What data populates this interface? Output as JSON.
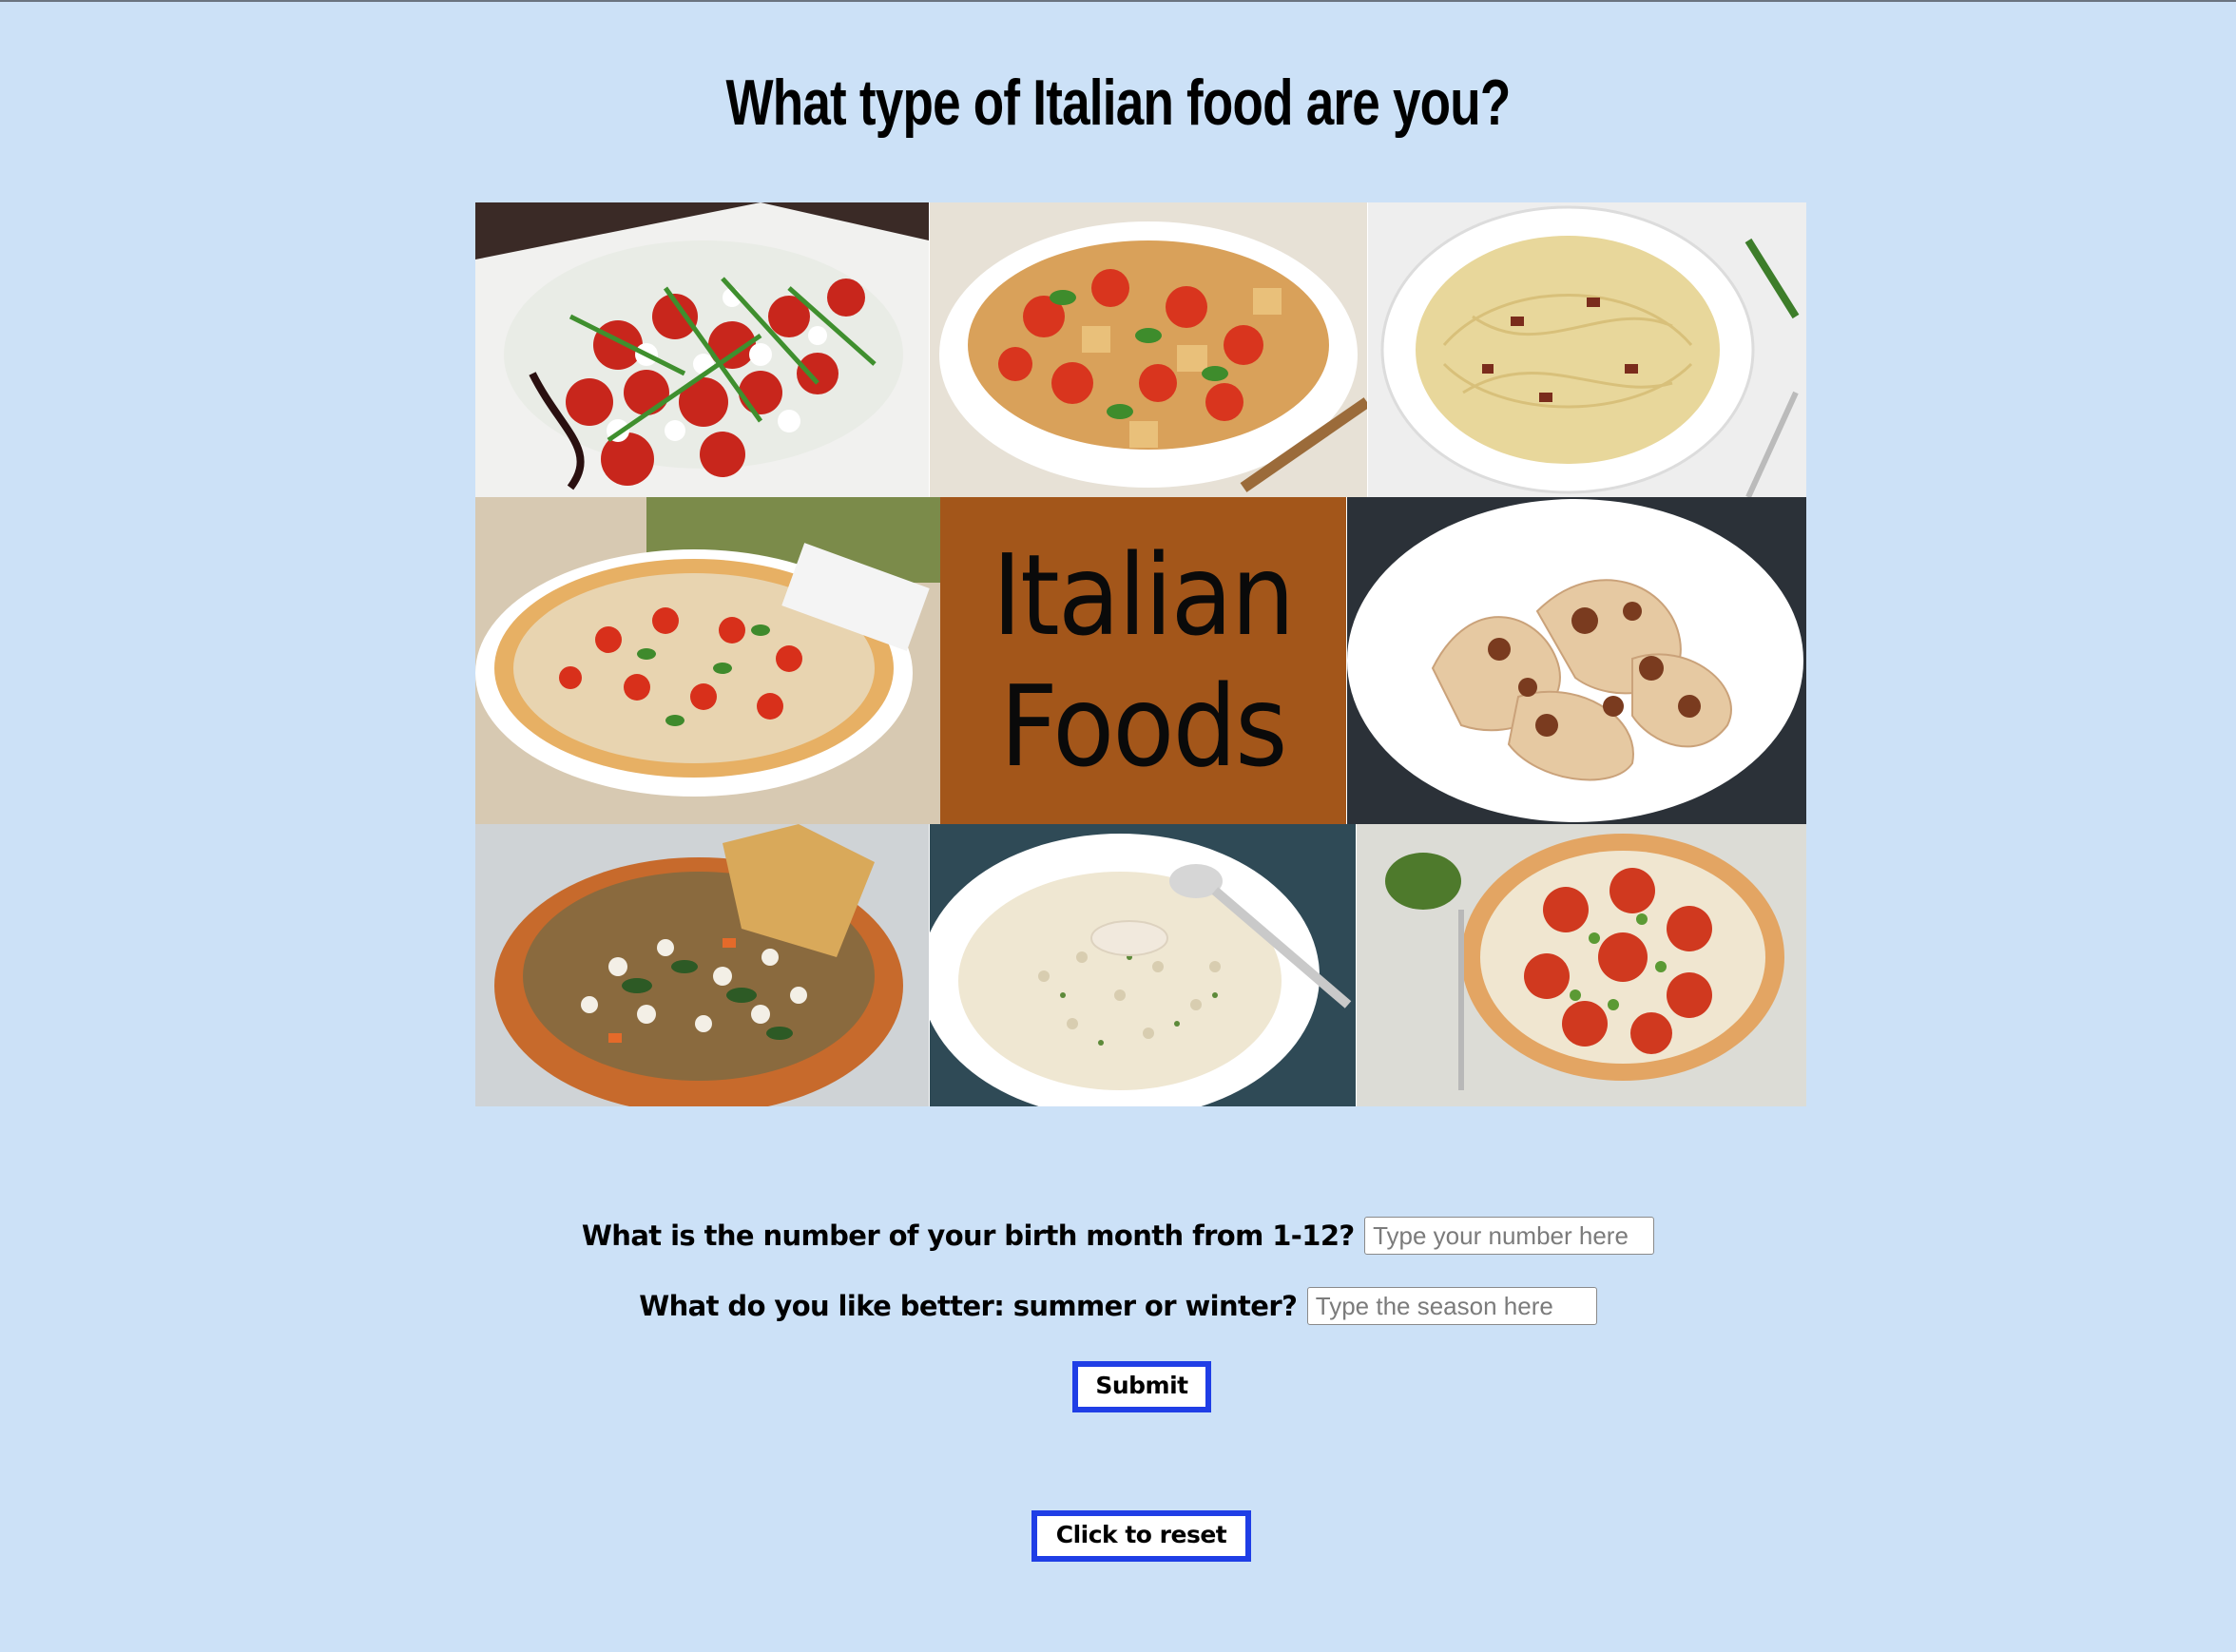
{
  "page": {
    "title": "What type of Italian food are you?"
  },
  "collage": {
    "center_line1": "Italian",
    "center_line2": "Foods",
    "tiles": [
      {
        "icon": "caprese-salad-image"
      },
      {
        "icon": "panzanella-salad-image"
      },
      {
        "icon": "spaghetti-carbonara-image"
      },
      {
        "icon": "margherita-pizza-image"
      },
      {
        "icon": "pappardelle-ragu-image"
      },
      {
        "icon": "ribollita-soup-image"
      },
      {
        "icon": "risotto-image"
      },
      {
        "icon": "tomato-pizza-image"
      }
    ]
  },
  "form": {
    "question1": "What is the number of your birth month from 1-12?",
    "question1_placeholder": "Type your number here",
    "question1_value": "",
    "question2": "What do you like better: summer or winter?",
    "question2_placeholder": "Type the season here",
    "question2_value": "",
    "submit_label": "Submit",
    "reset_label": "Click to reset"
  },
  "colors": {
    "background": "#cce1f7",
    "button_border": "#1f3ee6",
    "center_tile": "#a3561a"
  }
}
